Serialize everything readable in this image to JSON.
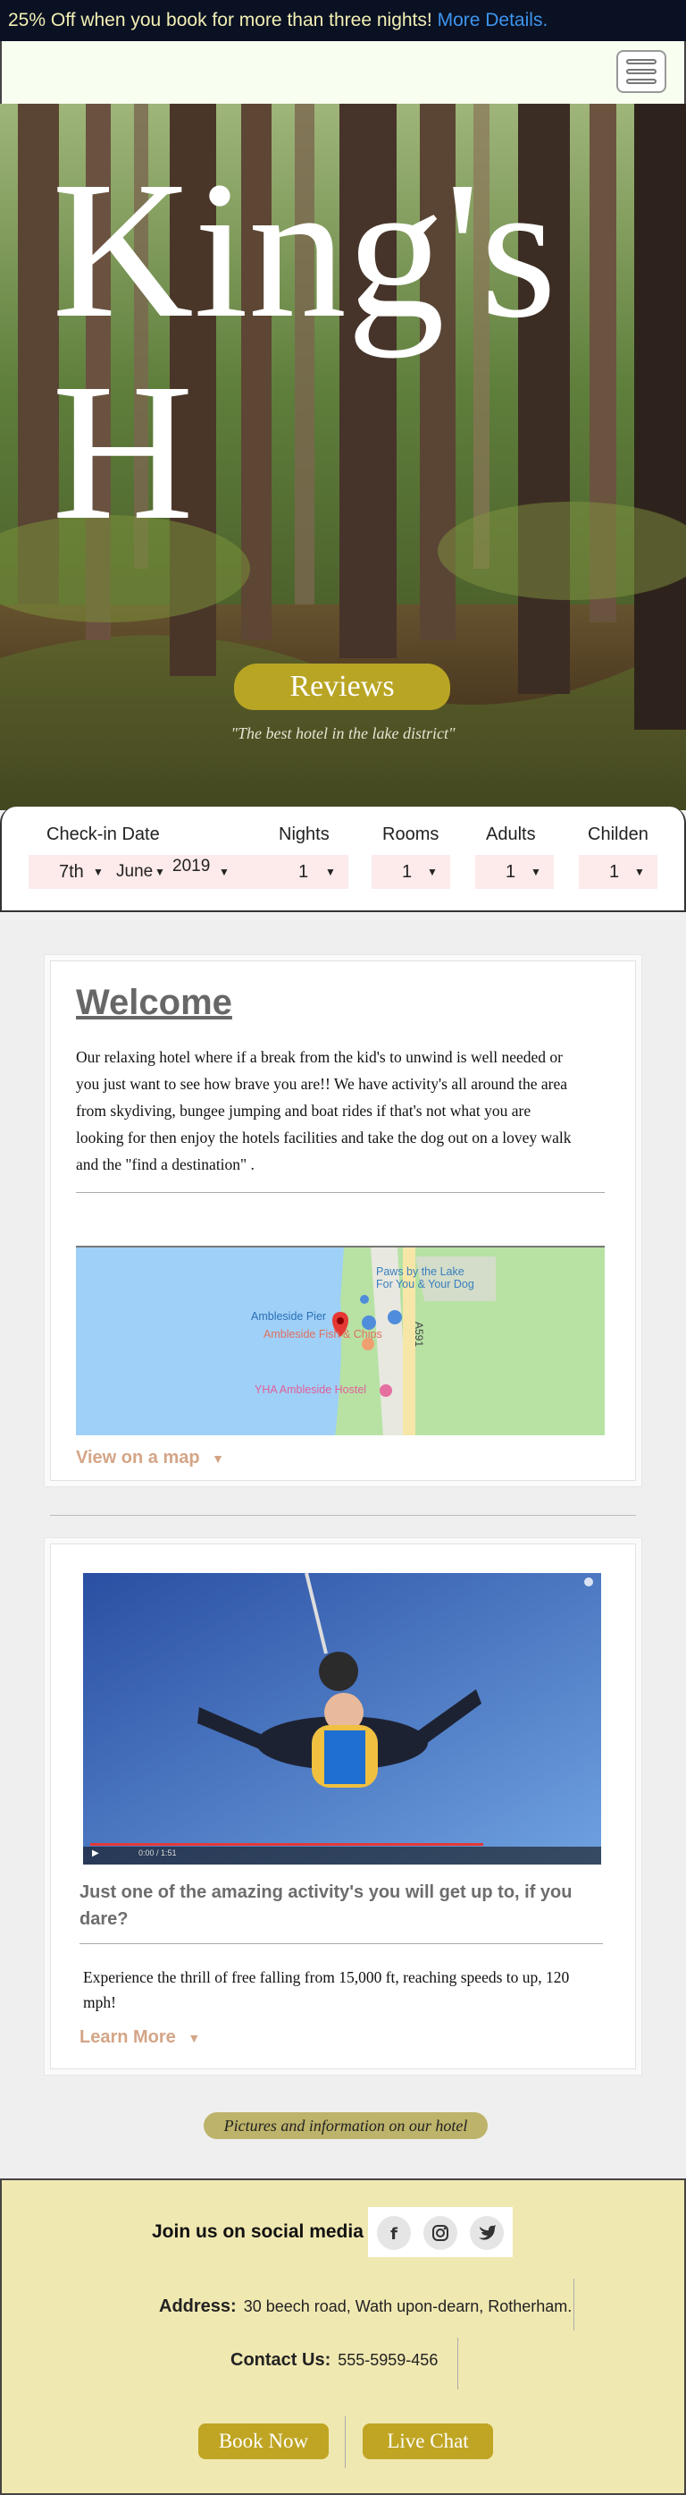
{
  "promo": {
    "text": "25% Off when you book for more than three nights!",
    "link": "More Details."
  },
  "nav": {
    "menu_icon": "hamburger-menu-icon"
  },
  "hero": {
    "title": "King's H",
    "reviews_label": "Reviews",
    "quote": "\"The best hotel in the lake district\""
  },
  "booking": {
    "checkin_label": "Check-in Date",
    "nights_label": "Nights",
    "rooms_label": "Rooms",
    "adults_label": "Adults",
    "children_label": "Childen",
    "day": "7th",
    "month": "June",
    "year": "2019",
    "nights": "1",
    "rooms": "1",
    "adults": "1",
    "children": "1"
  },
  "welcome": {
    "title": "Welcome",
    "text": "Our relaxing hotel where if a break from the kid's to unwind is well needed or you just want to see how brave you are!! We have activity's all around the area from skydiving, bungee jumping and boat rides if that's not what you are looking for then enjoy the hotels facilities and take the dog out on a lovey walk and the \"find a destination\" .",
    "map_labels": {
      "poi1": "Paws by the Lake",
      "poi1b": "For You & Your Dog",
      "pier": "Ambleside Pier",
      "fish": "Ambleside Fish & Chips",
      "road": "A591",
      "hostel": "YHA Ambleside Hostel"
    },
    "map_link": "View on a map"
  },
  "activity": {
    "title": "Just one of the amazing activity's you will get up to, if you dare?",
    "text": "Experience the thrill of free falling from 15,000 ft, reaching speeds to up, 120 mph!",
    "link": "Learn More",
    "video_time": "0:00 / 1:51"
  },
  "pictures_button": "Pictures and information on our hotel",
  "footer": {
    "join": "Join us on social media",
    "address_label": "Address:",
    "address": "30 beech road, Wath upon-dearn, Rotherham.",
    "contact_label": "Contact Us:",
    "phone": "555-5959-456",
    "book_now": "Book Now",
    "live_chat": "Live Chat",
    "social": [
      "facebook-icon",
      "instagram-icon",
      "twitter-icon"
    ]
  },
  "colors": {
    "promo_bg": "#0a1123",
    "promo_text": "#f2efb4",
    "link_blue": "#3e95ee",
    "gold": "#b9a524",
    "footer_bg": "#f0e8b1",
    "toggle_link": "#d4a587"
  }
}
